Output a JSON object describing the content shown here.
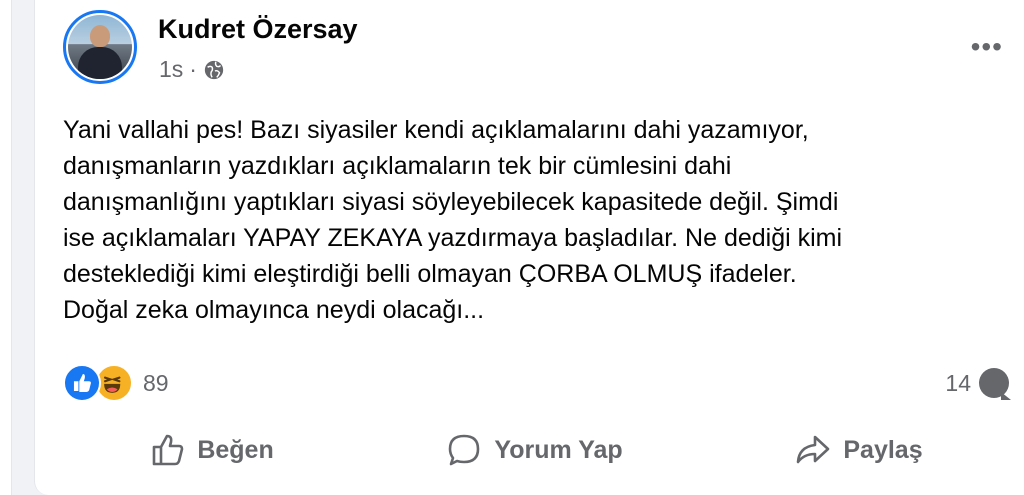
{
  "post": {
    "author": "Kudret Özersay",
    "time": "1s",
    "separator": "·",
    "more_label": "•••",
    "text": "Yani vallahi pes! Bazı siyasiler kendi açıklamalarını dahi yazamıyor,\ndanışmanların yazdıkları açıklamaların tek bir cümlesini dahi\ndanışmanlığını yaptıkları siyasi söyleyebilecek kapasitede değil. Şimdi\nise açıklamaları YAPAY ZEKAYA yazdırmaya başladılar. Ne dediği kimi\ndesteklediği kimi eleştirdiği belli olmayan ÇORBA OLMUŞ ifadeler.\nDoğal zeka olmayınca neydi olacağı..."
  },
  "stats": {
    "reactions_count": "89",
    "reaction_icons": [
      "like-icon",
      "haha-icon"
    ],
    "comments_count": "14"
  },
  "actions": {
    "like_label": "Beğen",
    "comment_label": "Yorum Yap",
    "share_label": "Paylaş"
  },
  "colors": {
    "accent": "#1877f2",
    "secondary_text": "#65676b",
    "haha": "#f7b125"
  }
}
